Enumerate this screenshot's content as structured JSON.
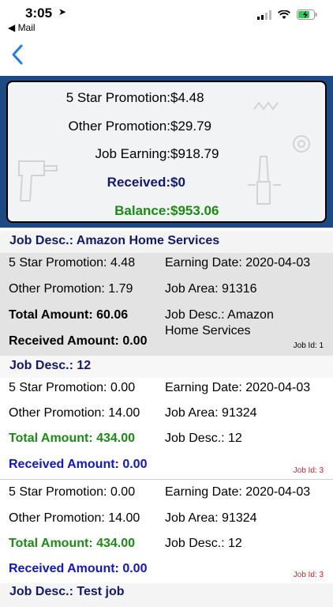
{
  "status_bar": {
    "time": "3:05",
    "back_app": "◀ Mail"
  },
  "summary": {
    "star_label": "5 Star Promotion:",
    "star_value": "$4.48",
    "other_label": "Other Promotion:",
    "other_value": "$29.79",
    "job_label": "Job Earning:",
    "job_value": "$918.79",
    "received_label": "Received:",
    "received_value": "$0",
    "balance_label": "Balance:",
    "balance_value": "$953.06"
  },
  "sections": [
    {
      "header": "Job Desc.: Amazon Home Services",
      "cards": [
        {
          "star": "5 Star Promotion: 4.48",
          "other": "Other Promotion: 1.79",
          "total": "Total Amount: 60.06",
          "received": "Received Amount: 0.00",
          "date": "Earning Date: 2020-04-03",
          "area": "Job Area: 91316",
          "desc": "Job Desc.: Amazon Home Services",
          "job_id": "Job Id: 1"
        }
      ]
    },
    {
      "header": "Job Desc.: 12",
      "cards": [
        {
          "star": "5 Star Promotion: 0.00",
          "other": "Other Promotion: 14.00",
          "total": "Total Amount: 434.00",
          "received": "Received Amount: 0.00",
          "date": "Earning Date: 2020-04-03",
          "area": "Job Area: 91324",
          "desc": "Job Desc.: 12",
          "job_id": "Job Id: 3"
        },
        {
          "star": "5 Star Promotion: 0.00",
          "other": "Other Promotion: 14.00",
          "total": "Total Amount: 434.00",
          "received": "Received Amount: 0.00",
          "date": "Earning Date: 2020-04-03",
          "area": "Job Area: 91324",
          "desc": "Job Desc.: 12",
          "job_id": "Job Id: 3"
        }
      ]
    },
    {
      "header": "Job Desc.: Test job"
    }
  ],
  "colors": {
    "summary_bg": "#1e4a84",
    "accent_blue": "#131a6e",
    "accent_green": "#1d8a18",
    "jobid_red": "#d32020"
  }
}
